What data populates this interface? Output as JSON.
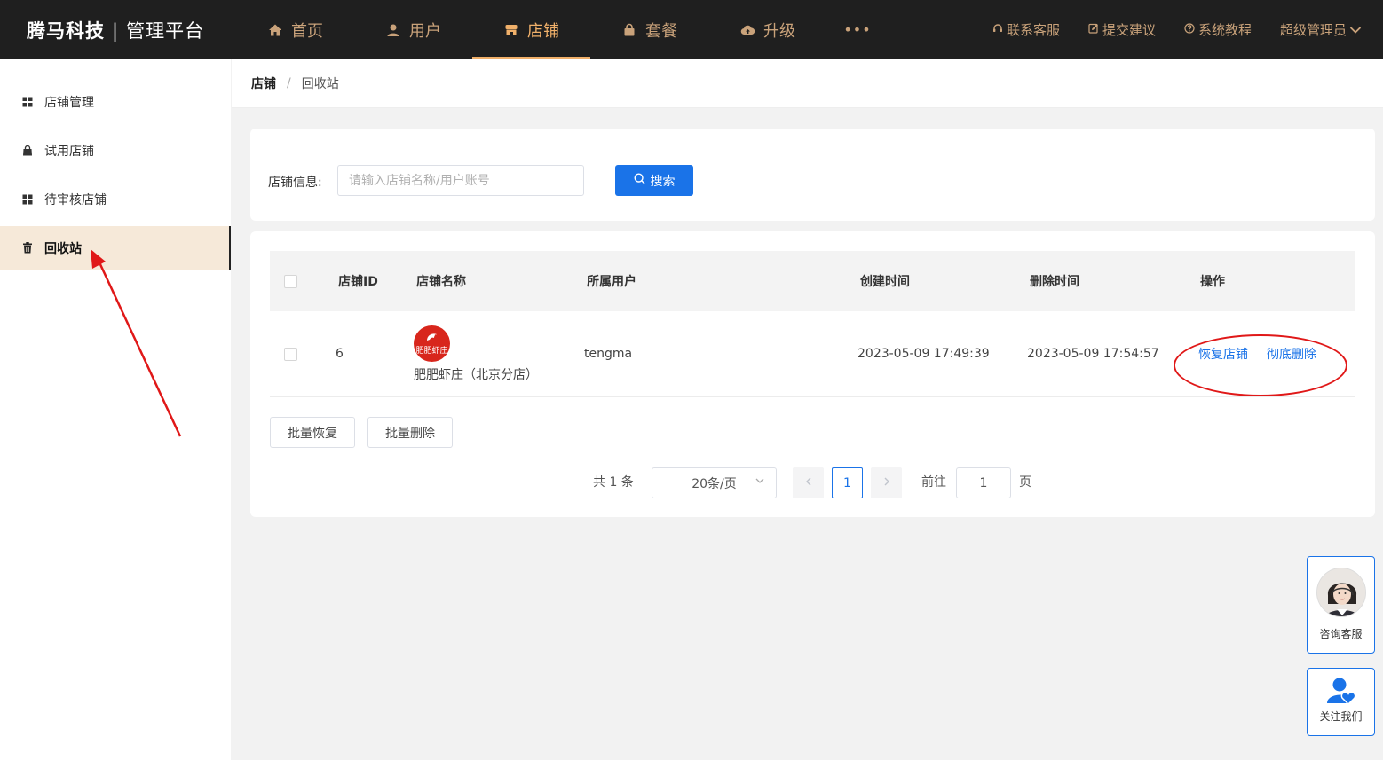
{
  "header": {
    "brand": "腾马科技",
    "brand_sep": "|",
    "brand_sub": "管理平台",
    "nav": [
      {
        "label": "首页",
        "icon": "home-icon"
      },
      {
        "label": "用户",
        "icon": "user-icon"
      },
      {
        "label": "店铺",
        "icon": "shop-icon",
        "active": true
      },
      {
        "label": "套餐",
        "icon": "lock-bag-icon"
      },
      {
        "label": "升级",
        "icon": "cloud-upload-icon"
      }
    ],
    "more": "•••",
    "links": [
      {
        "label": "联系客服",
        "icon": "headset-icon"
      },
      {
        "label": "提交建议",
        "icon": "edit-icon"
      },
      {
        "label": "系统教程",
        "icon": "help-icon"
      }
    ],
    "user": "超级管理员"
  },
  "sidebar": {
    "items": [
      {
        "label": "店铺管理",
        "icon": "grid-icon"
      },
      {
        "label": "试用店铺",
        "icon": "bag-icon"
      },
      {
        "label": "待审核店铺",
        "icon": "grid-icon"
      },
      {
        "label": "回收站",
        "icon": "trash-icon",
        "active": true
      }
    ]
  },
  "breadcrumb": {
    "first": "店铺",
    "sep": "/",
    "current": "回收站"
  },
  "search": {
    "label": "店铺信息:",
    "placeholder": "请输入店铺名称/用户账号",
    "value": "",
    "button": "搜索"
  },
  "table": {
    "columns": [
      "店铺ID",
      "店铺名称",
      "所属用户",
      "创建时间",
      "删除时间",
      "操作"
    ],
    "rows": [
      {
        "id": "6",
        "logo_text": "肥肥虾庄",
        "name": "肥肥虾庄（北京分店）",
        "user": "tengma",
        "created": "2023-05-09 17:49:39",
        "deleted": "2023-05-09 17:54:57",
        "actions": [
          "恢复店铺",
          "彻底删除"
        ]
      }
    ]
  },
  "batch": {
    "restore": "批量恢复",
    "delete": "批量删除"
  },
  "pagination": {
    "total": "共 1 条",
    "page_size": "20条/页",
    "current": "1",
    "goto_label": "前往",
    "goto_value": "1",
    "page_unit": "页"
  },
  "float": {
    "consult": "咨询客服",
    "follow": "关注我们"
  },
  "colors": {
    "topbar": "#1f1f1f",
    "nav_text": "#c9a27a",
    "nav_active": "#f0b06a",
    "primary": "#1a73e8",
    "annotation": "#e01818",
    "sidebar_active": "#f6e9d9"
  }
}
